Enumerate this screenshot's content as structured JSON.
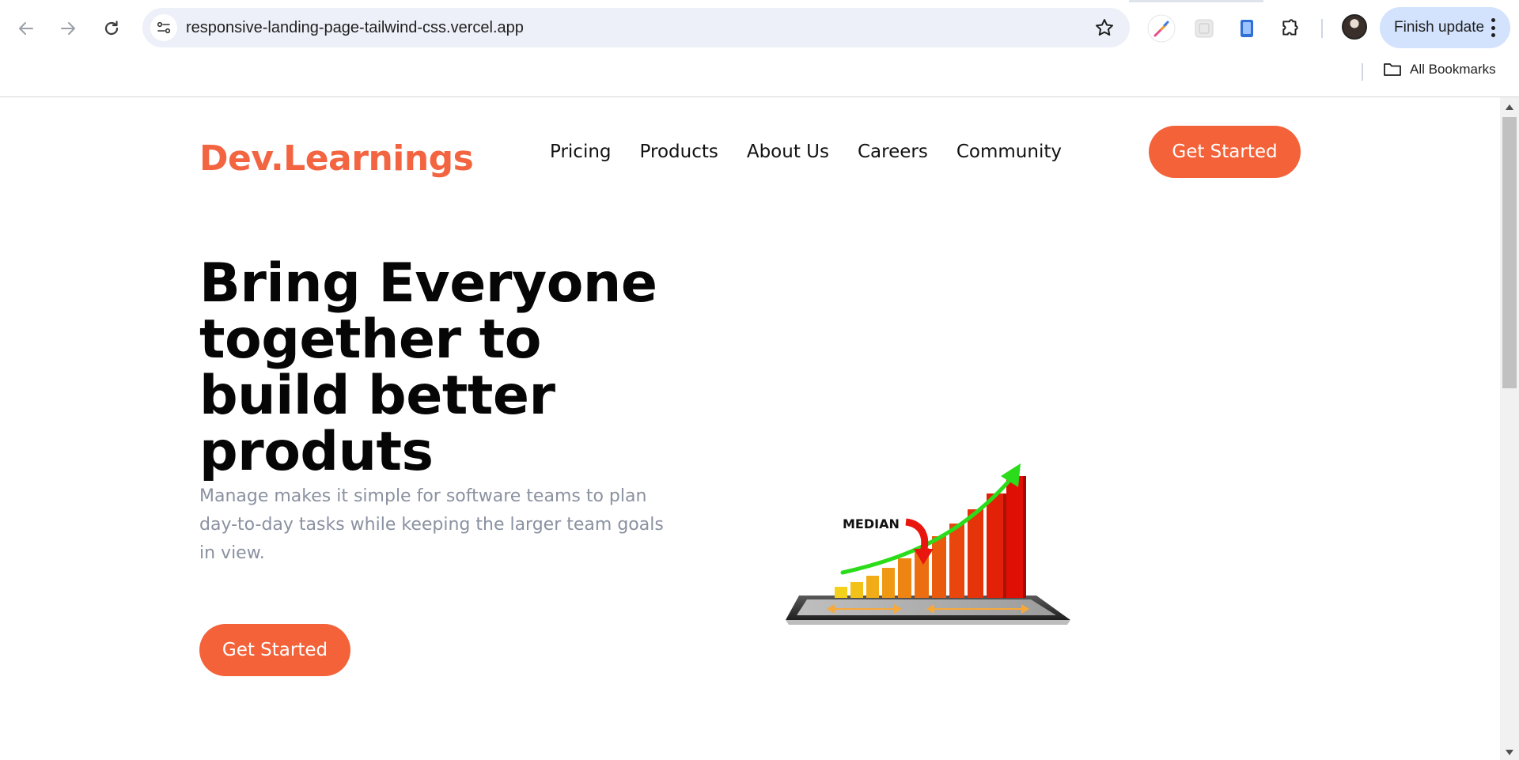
{
  "browser": {
    "url": "responsive-landing-page-tailwind-css.vercel.app",
    "finish_update_label": "Finish update",
    "bookmarks_label": "All Bookmarks"
  },
  "site": {
    "logo": "Dev.Learnings",
    "nav": [
      "Pricing",
      "Products",
      "About Us",
      "Careers",
      "Community"
    ],
    "header_cta": "Get Started",
    "hero": {
      "title": "Bring Everyone together to build better produts",
      "subtitle": "Manage makes it simple for software teams to plan day-to-day tasks while keeping the larger team goals in view.",
      "cta": "Get Started",
      "image_label": "MEDIAN"
    }
  },
  "colors": {
    "accent": "#f4623a",
    "text_muted": "#8a91a0",
    "omnibox_bg": "#edf0f8",
    "update_pill_bg": "#d3e2fd"
  },
  "icons": [
    "back-arrow-icon",
    "forward-arrow-icon",
    "reload-icon",
    "site-info-icon",
    "star-icon",
    "color-picker-extension-icon",
    "grid-extension-icon",
    "device-extension-icon",
    "puzzle-extensions-icon",
    "profile-avatar",
    "kebab-menu-icon",
    "folder-icon"
  ]
}
